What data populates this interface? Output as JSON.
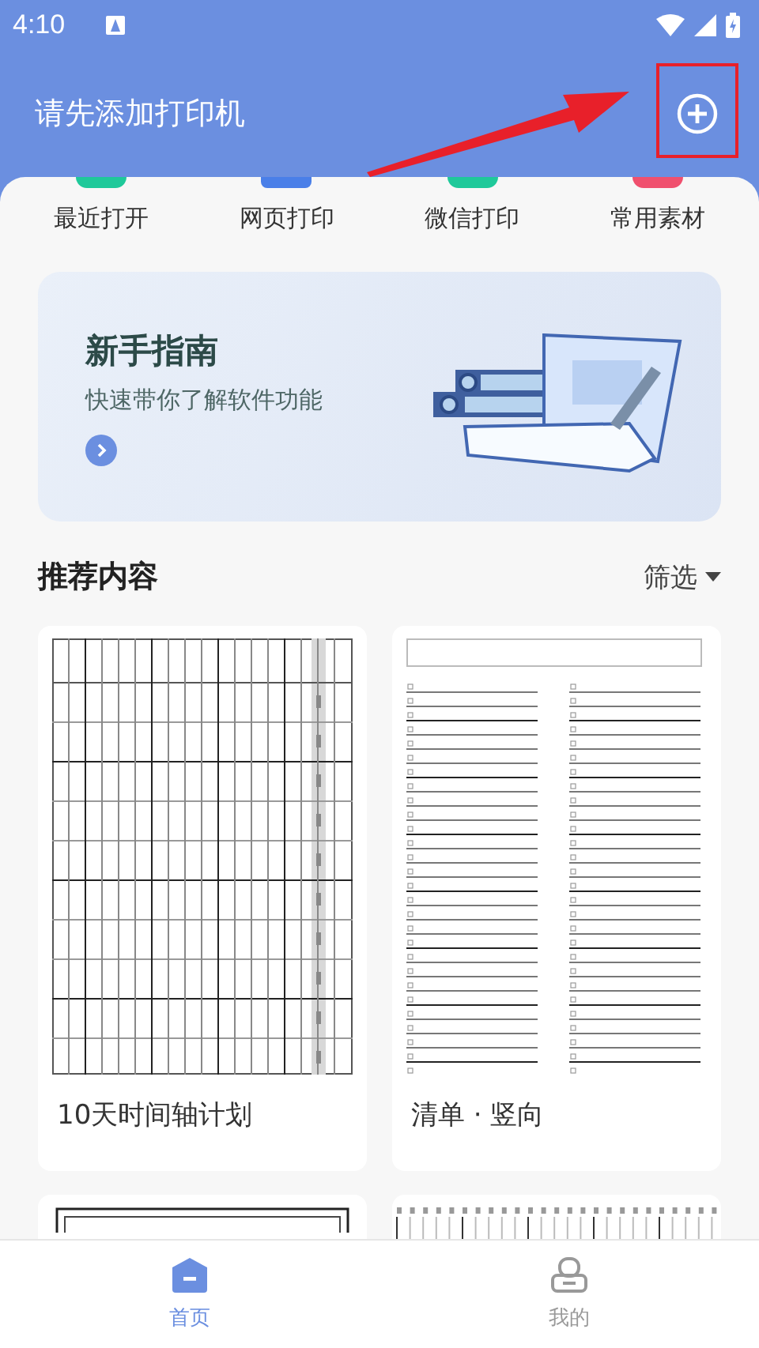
{
  "status_bar": {
    "time": "4:10"
  },
  "header": {
    "title": "请先添加打印机"
  },
  "quick_actions": [
    {
      "label": "最近打开",
      "color": "#1fc99a"
    },
    {
      "label": "网页打印",
      "color": "#4a7fe8"
    },
    {
      "label": "微信打印",
      "color": "#1fc99a"
    },
    {
      "label": "常用素材",
      "color": "#f0506e"
    }
  ],
  "banner": {
    "title": "新手指南",
    "subtitle": "快速带你了解软件功能"
  },
  "section": {
    "title": "推荐内容",
    "filter": "筛选"
  },
  "templates": [
    {
      "kind": "timeline",
      "title": "10天时间轴计划"
    },
    {
      "kind": "checklist",
      "title": "清单 · 竖向"
    },
    {
      "kind": "frame"
    },
    {
      "kind": "columns"
    }
  ],
  "tabs": [
    {
      "label": "首页",
      "selected": true
    },
    {
      "label": "我的",
      "selected": false
    }
  ]
}
